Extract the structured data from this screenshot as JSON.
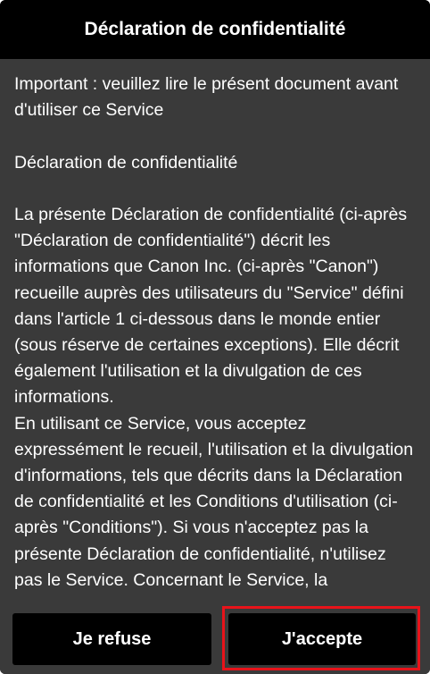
{
  "header": {
    "title": "Déclaration de confidentialité"
  },
  "document": {
    "paragraphs": [
      "Important : veuillez lire le présent document avant d'utiliser ce Service",
      "Déclaration de confidentialité",
      "La présente Déclaration de confidentialité (ci-après \"Déclaration de confidentialité\") décrit les informations que Canon Inc. (ci-après \"Canon\") recueille auprès des utilisateurs du \"Service\" défini dans l'article 1 ci-dessous dans le monde entier (sous réserve de certaines exceptions). Elle décrit également l'utilisation et la divulgation de ces informations.",
      "En utilisant ce Service, vous acceptez expressément le recueil, l'utilisation et la divulgation d'informations, tels que décrits dans la Déclaration de confidentialité et les Conditions d'utilisation (ci-après \"Conditions\"). Si vous n'acceptez pas la présente Déclaration de confidentialité, n'utilisez pas le Service. Concernant le Service, la"
    ]
  },
  "footer": {
    "refuse_label": "Je refuse",
    "accept_label": "J'accepte"
  },
  "colors": {
    "header_bg": "#000000",
    "body_bg": "#3a3a3a",
    "button_bg": "#000000",
    "highlight": "#e8131a"
  }
}
